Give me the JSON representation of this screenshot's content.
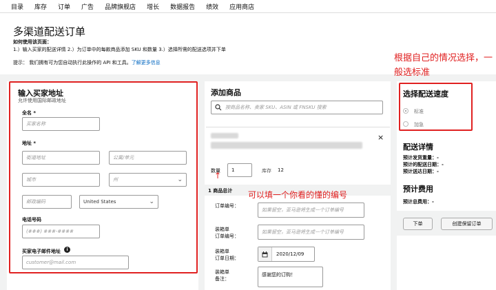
{
  "nav": [
    "目录",
    "库存",
    "订单",
    "广告",
    "品牌旗舰店",
    "增长",
    "数据报告",
    "绩效",
    "应用商店"
  ],
  "page": {
    "title": "多渠道配送订单",
    "howto_title": "如何使用该页面：",
    "howto_steps": "1.）输入买家的配送详情 2.）为订单中的每款商品添加 SKU 和数量 3.）选择所需的配送选项并下单",
    "tip_prefix": "提示： 我们拥有可为您自动执行此操作的 API 和工具。",
    "tip_link": "了解更多信息"
  },
  "buyer": {
    "heading": "输入买家地址",
    "sub": "允许使用国际邮政地址",
    "fullname_label": "全名 *",
    "fullname_placeholder": "买家名称",
    "address_label": "地址 *",
    "street_placeholder": "街道地址",
    "apt_placeholder": "公寓/单元",
    "city_placeholder": "城市",
    "state_placeholder": "州",
    "zip_placeholder": "邮政编码",
    "country_value": "United States",
    "phone_label": "电话号码",
    "phone_placeholder": "(###) ###-####",
    "email_label": "买家电子邮件地址",
    "email_placeholder": "customer@mail.com"
  },
  "products": {
    "heading": "添加商品",
    "search_placeholder": "按商品名称、卖家 SKU、ASIN 或 FNSKU 搜索",
    "close": "×",
    "qty_label": "数量",
    "qty_value": "1",
    "stock_label": "库存",
    "stock_value": "12",
    "summary": "1 商品总计",
    "order_no_label": "订单编号：",
    "order_no_placeholder": "如果留空，亚马逊将生成一个订单编号",
    "packing_no_label": "装箱单\n订单编号：",
    "packing_no_placeholder": "如果留空，亚马逊将生成一个订单编号",
    "packing_date_label": "装箱单\n订单日期：",
    "packing_date_value": "2020/12/09",
    "packing_note_label": "装箱单\n备注：",
    "packing_note_value": "感谢您的订购！"
  },
  "shipping": {
    "heading": "选择配送速度",
    "options": [
      "标准",
      "加急"
    ],
    "details_heading": "配送详情",
    "est_weight": "预计发货重量：-",
    "est_ship_date": "预计的配送日期：-",
    "est_arrival": "预计送达日期：-",
    "fees_heading": "预计费用",
    "total_fee": "预计总费用：-",
    "place_order": "下单",
    "create_hold": "创建保留订单"
  },
  "annotations": {
    "speed_note": "根据自己的情况选择，一般选标准",
    "order_no_note": "可以填一个你看的懂的编号"
  },
  "watermark": "知乎 @K卡带",
  "colors": {
    "annotation": "#e02020",
    "link": "#0066c0"
  }
}
